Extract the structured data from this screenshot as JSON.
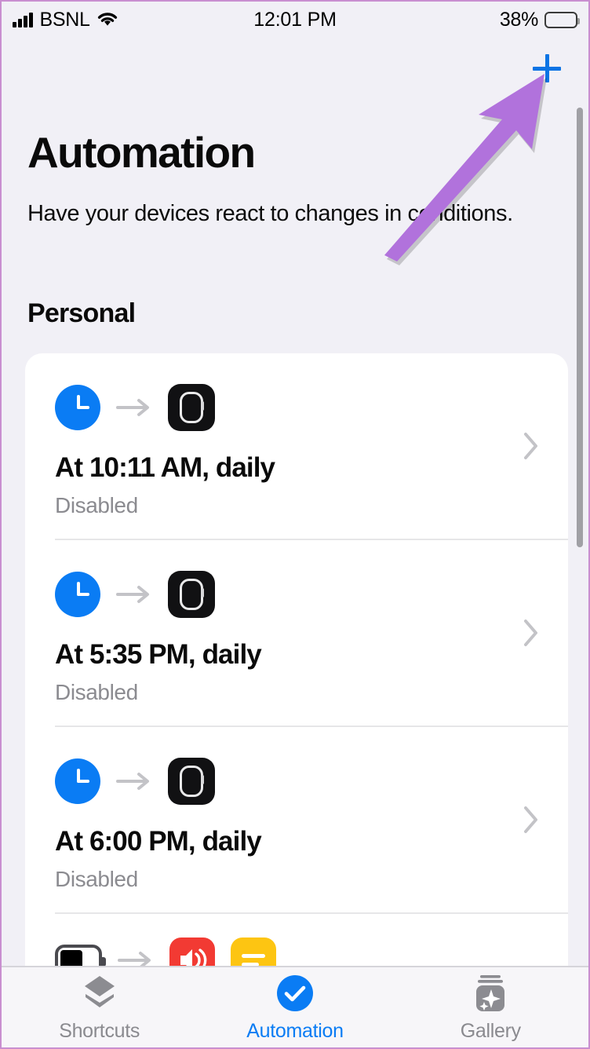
{
  "statusbar": {
    "carrier": "BSNL",
    "time": "12:01 PM",
    "battery_percent": "38%",
    "battery_level": 38,
    "signal_bars": 4,
    "wifi_icon": "wifi-icon",
    "battery_icon": "battery-icon"
  },
  "header": {
    "add_icon": "plus-icon",
    "title": "Automation",
    "subtitle": "Have your devices react to changes in conditions.",
    "section": "Personal"
  },
  "annotation": {
    "arrow_color": "#b172dc",
    "points_to": "add-automation-button"
  },
  "colors": {
    "accent_blue": "#0a7cf4",
    "page_background": "#f1f0f6",
    "card_background": "#ffffff",
    "muted_text": "#8b8b90",
    "border_highlight": "#c98fd0"
  },
  "automations": [
    {
      "trigger_icon": "clock-icon",
      "arrow_icon": "arrow-right-icon",
      "action_icon": "apple-watch-icon",
      "title": "At 10:11 AM, daily",
      "status": "Disabled",
      "chevron_icon": "chevron-right-icon"
    },
    {
      "trigger_icon": "clock-icon",
      "arrow_icon": "arrow-right-icon",
      "action_icon": "apple-watch-icon",
      "title": "At 5:35 PM, daily",
      "status": "Disabled",
      "chevron_icon": "chevron-right-icon"
    },
    {
      "trigger_icon": "clock-icon",
      "arrow_icon": "arrow-right-icon",
      "action_icon": "apple-watch-icon",
      "title": "At 6:00 PM, daily",
      "status": "Disabled",
      "chevron_icon": "chevron-right-icon"
    }
  ],
  "partial_row": {
    "trigger_icon": "battery-level-icon",
    "arrow_icon": "arrow-right-icon",
    "action_icons": [
      "speaker-volume-icon",
      "notes-icon"
    ]
  },
  "tabbar": {
    "tabs": [
      {
        "label": "Shortcuts",
        "icon": "shortcuts-icon",
        "active": false
      },
      {
        "label": "Automation",
        "icon": "automation-check-icon",
        "active": true
      },
      {
        "label": "Gallery",
        "icon": "gallery-sparkle-icon",
        "active": false
      }
    ]
  },
  "scrollbar": {
    "name": "vertical-scrollbar"
  }
}
